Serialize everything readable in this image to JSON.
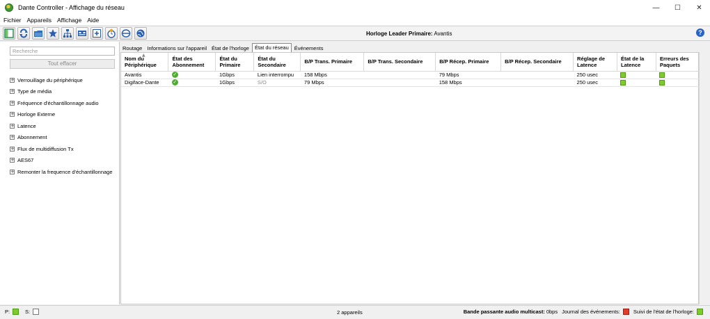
{
  "window": {
    "title": "Dante Controller - Affichage du réseau",
    "controls": [
      "minimize",
      "maximize",
      "close"
    ]
  },
  "menu": [
    "Fichier",
    "Appareils",
    "Affichage",
    "Aide"
  ],
  "toolbar": {
    "leader_label": "Horloge Leader Primaire:",
    "leader_value": "Avantis",
    "icons": [
      "panel-icon",
      "refresh-icon",
      "folder-icon",
      "star-icon",
      "network-icon",
      "device-view-icon",
      "add-icon",
      "clock-icon",
      "subscription-icon",
      "globe-icon"
    ]
  },
  "filter_panel": {
    "search_placeholder": "Recherche",
    "clear_label": "Tout effacer",
    "items": [
      "Verrouillage du périphérique",
      "Type de média",
      "Fréquence d'échantillonnage audio",
      "Horloge Externe",
      "Latence",
      "Abonnement",
      "Flux de multidiffusion Tx",
      "AES67",
      "Remonter la frequence d'échantillonnage"
    ]
  },
  "tabs": [
    {
      "label": "Routage",
      "active": false
    },
    {
      "label": "Informations sur l'appareil",
      "active": false
    },
    {
      "label": "État de l'horloge",
      "active": false
    },
    {
      "label": "État du réseau",
      "active": true
    },
    {
      "label": "Événements",
      "active": false
    }
  ],
  "table": {
    "columns": [
      [
        "Nom du",
        "Périphérique"
      ],
      [
        "État des",
        "Abonnement"
      ],
      [
        "État du",
        "Primaire"
      ],
      [
        "État du",
        "Secondaire"
      ],
      [
        "B/P Trans. Primaire",
        ""
      ],
      [
        "B/P Trans. Secondaire",
        ""
      ],
      [
        "B/P Récep. Primaire",
        ""
      ],
      [
        "B/P Récep. Secondaire",
        ""
      ],
      [
        "Réglage de",
        "Latence"
      ],
      [
        "État de la",
        "Latence"
      ],
      [
        "Erreurs des",
        "Paquets"
      ]
    ],
    "rows": [
      {
        "name": "Avantis",
        "subscription": "ok",
        "primary": "1Gbps",
        "secondary": "Lien interrompu",
        "tx_primary": "158 Mbps",
        "tx_secondary": "",
        "rx_primary": "79 Mbps",
        "rx_secondary": "",
        "latency_setting": "250 usec",
        "latency_state": "green",
        "packet_errors": "green"
      },
      {
        "name": "Digiface-Dante",
        "subscription": "ok",
        "primary": "1Gbps",
        "secondary": "S/O",
        "tx_primary": "79 Mbps",
        "tx_secondary": "",
        "rx_primary": "158 Mbps",
        "rx_secondary": "",
        "latency_setting": "250 usec",
        "latency_state": "green",
        "packet_errors": "green"
      }
    ]
  },
  "statusbar": {
    "p_label": "P:",
    "s_label": "S:",
    "device_count": "2 appareils",
    "multicast_label": "Bande passante audio multicast:",
    "multicast_value": "0bps",
    "events_label": "Journal des événements:",
    "clock_label": "Suivi de l'état de l'horloge:"
  },
  "colors": {
    "ok_green": "#4caf2e",
    "status_green": "#7fcb2a",
    "event_red": "#e23b2a",
    "help_blue": "#2a63c6"
  }
}
